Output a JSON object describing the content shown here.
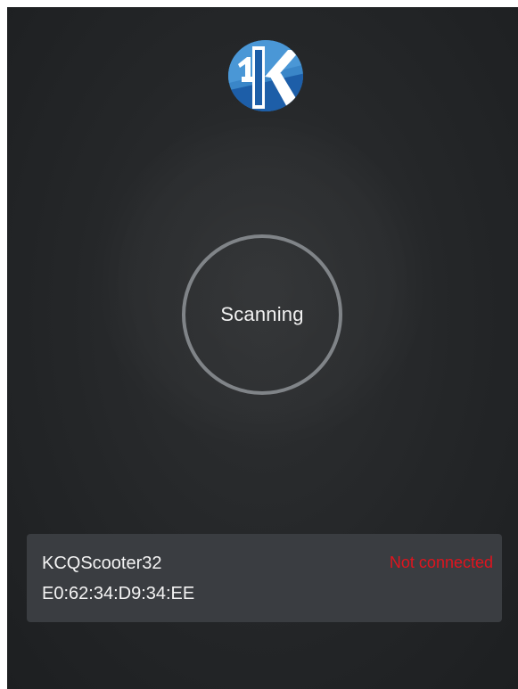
{
  "app": {
    "logo_icon": "k-brand-logo-icon",
    "logo_colors": [
      "#3a86c8",
      "#1d5ea8",
      "#ffffff"
    ]
  },
  "scanner": {
    "label": "Scanning",
    "ring_color": "#808488"
  },
  "devices": [
    {
      "name": "KCQScooter32",
      "mac": "E0:62:34:D9:34:EE",
      "status": "Not connected",
      "status_color": "#e0141e"
    }
  ]
}
